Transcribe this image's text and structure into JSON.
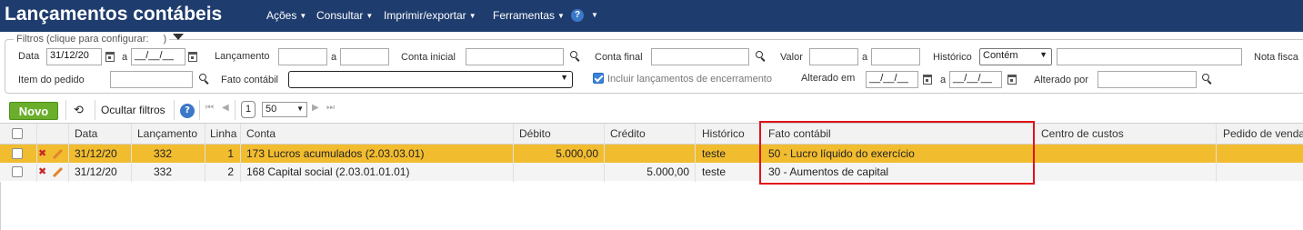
{
  "header": {
    "title": "Lançamentos contábeis",
    "menus": [
      {
        "label": "Ações"
      },
      {
        "label": "Consultar"
      },
      {
        "label": "Imprimir/exportar"
      },
      {
        "label": "Ferramentas"
      }
    ],
    "help": "?"
  },
  "filters": {
    "legend": "Filtros (clique para configurar:",
    "legend_close": ")",
    "data_label": "Data",
    "data_from": "31/12/20",
    "range_sep": "a",
    "data_to": "__/__/__",
    "lancamento_label": "Lançamento",
    "lancamento_from": "",
    "lancamento_to": "",
    "conta_inicial_label": "Conta inicial",
    "conta_inicial": "",
    "conta_final_label": "Conta final",
    "conta_final": "",
    "valor_label": "Valor",
    "valor_from": "",
    "valor_to": "",
    "historico_label": "Histórico",
    "historico_mode": "Contém",
    "historico_value": "",
    "nota_fiscal_label": "Nota fisca",
    "item_pedido_label": "Item do pedido",
    "item_pedido": "",
    "fato_label": "Fato contábil",
    "fato_value": "",
    "incluir_label": "Incluir lançamentos de encerramento",
    "alterado_em_label": "Alterado em",
    "alterado_em_from": "__/__/__",
    "alterado_em_to": "__/__/__",
    "alterado_por_label": "Alterado por",
    "alterado_por": ""
  },
  "toolbar": {
    "novo": "Novo",
    "ocultar": "Ocultar filtros",
    "page": "1",
    "page_size": "50"
  },
  "grid": {
    "columns": [
      "Data",
      "Lançamento",
      "Linha",
      "Conta",
      "Débito",
      "Crédito",
      "Histórico",
      "Fato contábil",
      "Centro de custos",
      "Pedido de venda"
    ],
    "rows": [
      {
        "data": "31/12/20",
        "lancamento": "332",
        "linha": "1",
        "conta": "173 Lucros acumulados (2.03.03.01)",
        "debito": "5.000,00",
        "credito": "",
        "historico": "teste",
        "fato": "50 - Lucro líquido do exercício",
        "centro": "",
        "pedido": ""
      },
      {
        "data": "31/12/20",
        "lancamento": "332",
        "linha": "2",
        "conta": "168 Capital social (2.03.01.01.01)",
        "debito": "",
        "credito": "5.000,00",
        "historico": "teste",
        "fato": "30 - Aumentos de capital",
        "centro": "",
        "pedido": ""
      }
    ]
  },
  "colors": {
    "header": "#1f3c6e",
    "selected_row": "#f2bc2f",
    "highlight": "#e0111b",
    "novo": "#6aae2b"
  }
}
